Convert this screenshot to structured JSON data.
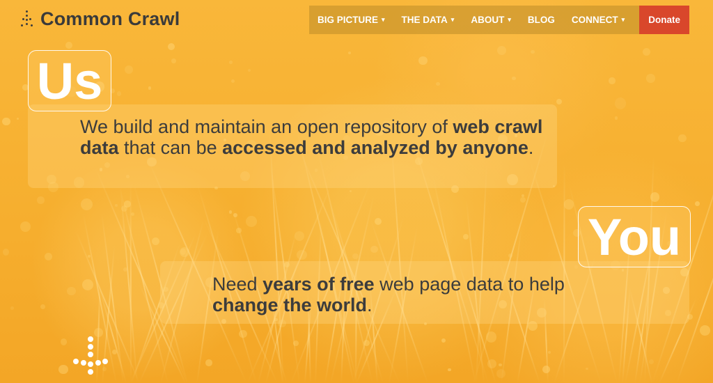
{
  "brand": {
    "name": "Common Crawl"
  },
  "nav": [
    {
      "label": "BIG PICTURE",
      "caret": "▾",
      "dropdown": true
    },
    {
      "label": "THE DATA",
      "caret": "▾",
      "dropdown": true
    },
    {
      "label": "ABOUT",
      "caret": "▾",
      "dropdown": true
    },
    {
      "label": "BLOG",
      "dropdown": false
    },
    {
      "label": "CONNECT",
      "caret": "▾",
      "dropdown": true
    },
    {
      "label": "Donate",
      "dropdown": false
    }
  ],
  "hero": {
    "us": {
      "badge": "Us",
      "t1": "We build and maintain an open repository of ",
      "b1": "web crawl data",
      "t2": " that can be ",
      "b2": "accessed and analyzed by anyone",
      "t3": "."
    },
    "you": {
      "badge": "You",
      "t1": "Need ",
      "b1": "years of free",
      "t2": " web page data to help ",
      "b2": "change the world",
      "t3": "."
    }
  },
  "icons": {
    "logo": "spider-logo-icon",
    "scroll": "scroll-down-arrow-icon"
  },
  "colors": {
    "background": "#f7b232",
    "donate": "#d9472b",
    "text": "#3c3c3c"
  }
}
